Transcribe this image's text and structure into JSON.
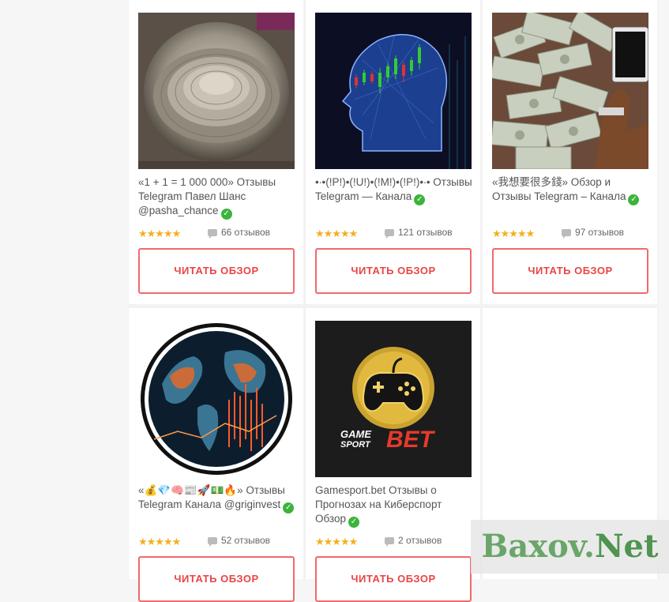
{
  "cards": [
    {
      "title": "«1 + 1 = 1 000 000» Отзывы Telegram Павел Шанс @pasha_chance",
      "verified": true,
      "stars": "★★★★★",
      "reviews": "66 отзывов",
      "button": "ЧИТАТЬ ОБЗОР",
      "image": "money-stacks-under-glass"
    },
    {
      "title": "•∙•(!P!)•(!U!)•(!M!)•(!P!)•∙• Отзывы Telegram — Канала",
      "verified": true,
      "stars": "★★★★★",
      "reviews": "121 отзывов",
      "button": "ЧИТАТЬ ОБЗОР",
      "image": "head-with-candlestick-chart"
    },
    {
      "title": "«我想要很多錢» Обзор и Отзывы Telegram – Канала",
      "verified": true,
      "stars": "★★★★★",
      "reviews": "97 отзывов",
      "button": "ЧИТАТЬ ОБЗОР",
      "image": "dollar-bills-and-phone"
    },
    {
      "title": "«💰💎🧠📰🚀💵🔥» Отзывы Telegram Канала @griginvest",
      "verified": true,
      "stars": "★★★★★",
      "reviews": "52 отзывов",
      "button": "ЧИТАТЬ ОБЗОР",
      "image": "world-map-with-chart-circle"
    },
    {
      "title": "Gamesport.bet Отзывы о Прогнозах на Киберспорт Обзор",
      "verified": true,
      "stars": "★★★★★",
      "reviews": "2 отзывов",
      "button": "ЧИТАТЬ ОБЗОР",
      "image": "gamesport-bet-logo"
    }
  ],
  "logo_text": {
    "game": "GAME",
    "sport": "SPORT",
    "bet": "BET"
  },
  "watermark": {
    "part1": "Baxov.",
    "part2": "Net"
  },
  "colors": {
    "button_border": "#f06a6a",
    "button_text": "#e84545",
    "star": "#f2b01e",
    "verified": "#3cb43c"
  }
}
